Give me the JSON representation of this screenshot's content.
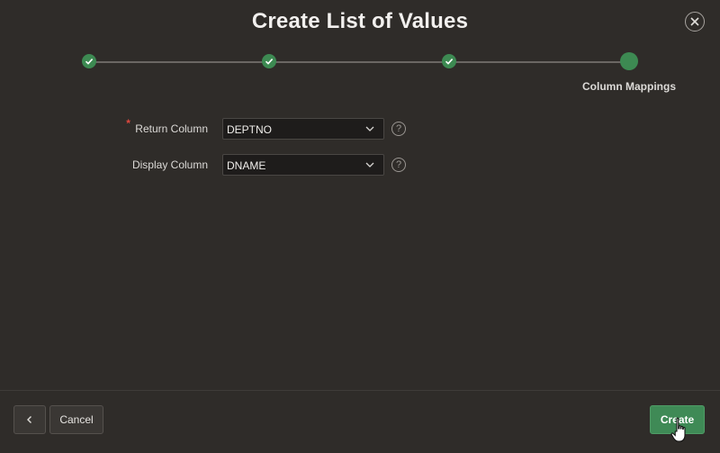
{
  "dialog": {
    "title": "Create List of Values",
    "close_icon": "close-icon"
  },
  "train": {
    "steps": [
      {
        "status": "complete",
        "icon": "check-icon"
      },
      {
        "status": "complete",
        "icon": "check-icon"
      },
      {
        "status": "complete",
        "icon": "check-icon"
      },
      {
        "status": "current",
        "label": "Column Mappings"
      }
    ]
  },
  "form": {
    "return_column": {
      "label": "Return Column",
      "required_marker": "*",
      "value": "DEPTNO",
      "help": "?"
    },
    "display_column": {
      "label": "Display Column",
      "value": "DNAME",
      "help": "?"
    }
  },
  "footer": {
    "back_icon": "chevron-left-icon",
    "cancel_label": "Cancel",
    "create_label": "Create"
  },
  "colors": {
    "background": "#2f2c29",
    "accent": "#3f8a56",
    "required": "#e0483e"
  }
}
